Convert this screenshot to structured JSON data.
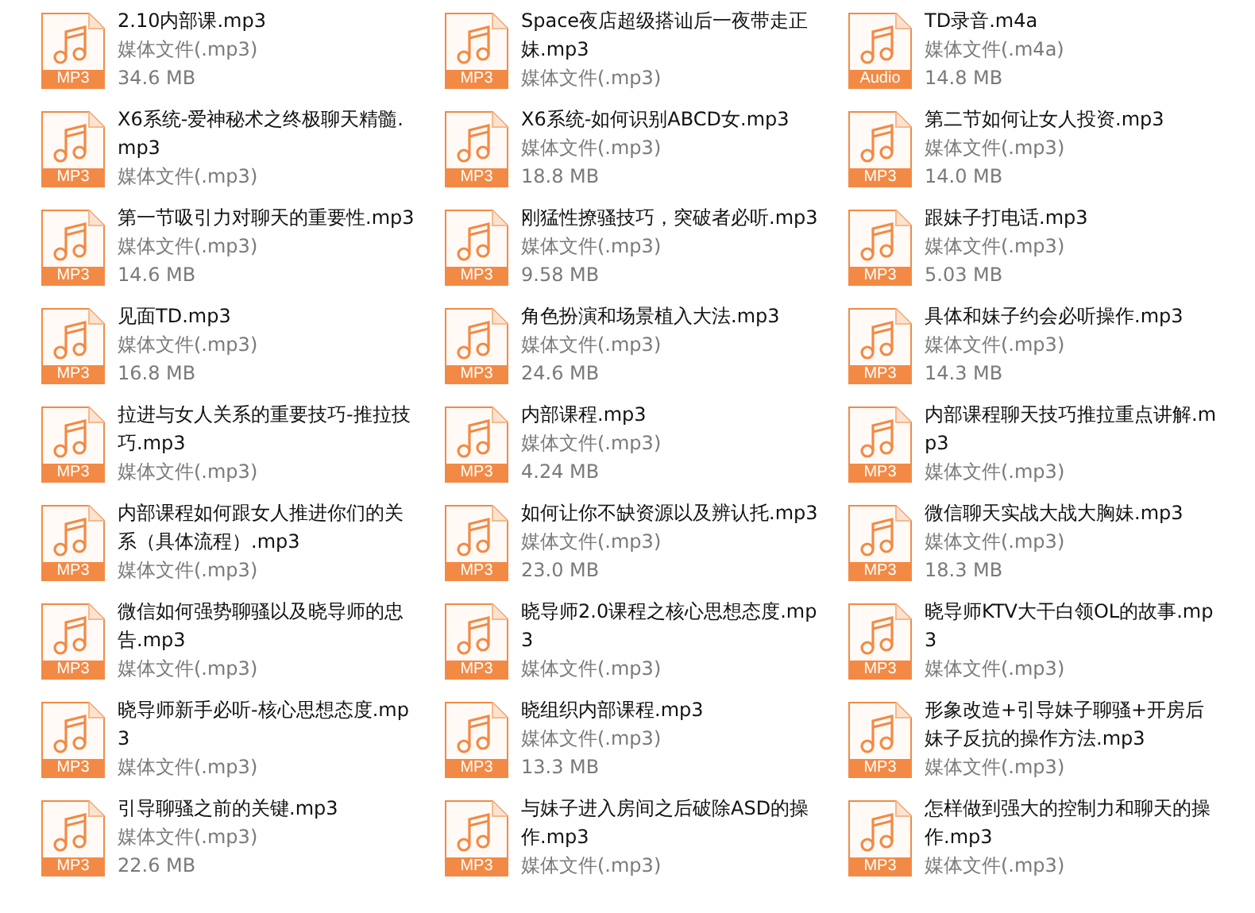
{
  "files": [
    {
      "name": "2.10内部课.mp3",
      "type": "媒体文件(.mp3)",
      "size": "34.6 MB",
      "badge": "MP3"
    },
    {
      "name": "Space夜店超级搭讪后一夜带走正妹.mp3",
      "type": "媒体文件(.mp3)",
      "badge": "MP3"
    },
    {
      "name": "TD录音.m4a",
      "type": "媒体文件(.m4a)",
      "size": "14.8 MB",
      "badge": "Audio"
    },
    {
      "name": "X6系统-爱神秘术之终极聊天精髓.mp3",
      "type": "媒体文件(.mp3)",
      "badge": "MP3"
    },
    {
      "name": "X6系统-如何识别ABCD女.mp3",
      "type": "媒体文件(.mp3)",
      "size": "18.8 MB",
      "badge": "MP3"
    },
    {
      "name": "第二节如何让女人投资.mp3",
      "type": "媒体文件(.mp3)",
      "size": "14.0 MB",
      "badge": "MP3"
    },
    {
      "name": "第一节吸引力对聊天的重要性.mp3",
      "type": "媒体文件(.mp3)",
      "size": "14.6 MB",
      "badge": "MP3"
    },
    {
      "name": "刚猛性撩骚技巧，突破者必听.mp3",
      "type": "媒体文件(.mp3)",
      "size": "9.58 MB",
      "badge": "MP3"
    },
    {
      "name": "跟妹子打电话.mp3",
      "type": "媒体文件(.mp3)",
      "size": "5.03 MB",
      "badge": "MP3"
    },
    {
      "name": "见面TD.mp3",
      "type": "媒体文件(.mp3)",
      "size": "16.8 MB",
      "badge": "MP3"
    },
    {
      "name": "角色扮演和场景植入大法.mp3",
      "type": "媒体文件(.mp3)",
      "size": "24.6 MB",
      "badge": "MP3"
    },
    {
      "name": "具体和妹子约会必听操作.mp3",
      "type": "媒体文件(.mp3)",
      "size": "14.3 MB",
      "badge": "MP3"
    },
    {
      "name": "拉进与女人关系的重要技巧-推拉技巧.mp3",
      "type": "媒体文件(.mp3)",
      "badge": "MP3"
    },
    {
      "name": "内部课程.mp3",
      "type": "媒体文件(.mp3)",
      "size": "4.24 MB",
      "badge": "MP3"
    },
    {
      "name": "内部课程聊天技巧推拉重点讲解.mp3",
      "type": "媒体文件(.mp3)",
      "badge": "MP3"
    },
    {
      "name": "内部课程如何跟女人推进你们的关系（具体流程）.mp3",
      "type": "媒体文件(.mp3)",
      "badge": "MP3"
    },
    {
      "name": "如何让你不缺资源以及辨认托.mp3",
      "type": "媒体文件(.mp3)",
      "size": "23.0 MB",
      "badge": "MP3"
    },
    {
      "name": "微信聊天实战大战大胸妹.mp3",
      "type": "媒体文件(.mp3)",
      "size": "18.3 MB",
      "badge": "MP3"
    },
    {
      "name": "微信如何强势聊骚以及晓导师的忠告.mp3",
      "type": "媒体文件(.mp3)",
      "badge": "MP3"
    },
    {
      "name": "晓导师2.0课程之核心思想态度.mp3",
      "type": "媒体文件(.mp3)",
      "badge": "MP3"
    },
    {
      "name": "晓导师KTV大干白领OL的故事.mp3",
      "type": "媒体文件(.mp3)",
      "badge": "MP3"
    },
    {
      "name": "晓导师新手必听-核心思想态度.mp3",
      "type": "媒体文件(.mp3)",
      "badge": "MP3"
    },
    {
      "name": "晓组织内部课程.mp3",
      "type": "媒体文件(.mp3)",
      "size": "13.3 MB",
      "badge": "MP3"
    },
    {
      "name": "形象改造+引导妹子聊骚+开房后妹子反抗的操作方法.mp3",
      "type": "媒体文件(.mp3)",
      "badge": "MP3"
    },
    {
      "name": "引导聊骚之前的关键.mp3",
      "type": "媒体文件(.mp3)",
      "size": "22.6 MB",
      "badge": "MP3"
    },
    {
      "name": "与妹子进入房间之后破除ASD的操作.mp3",
      "type": "媒体文件(.mp3)",
      "badge": "MP3"
    },
    {
      "name": "怎样做到强大的控制力和聊天的操作.mp3",
      "type": "媒体文件(.mp3)",
      "badge": "MP3"
    }
  ]
}
